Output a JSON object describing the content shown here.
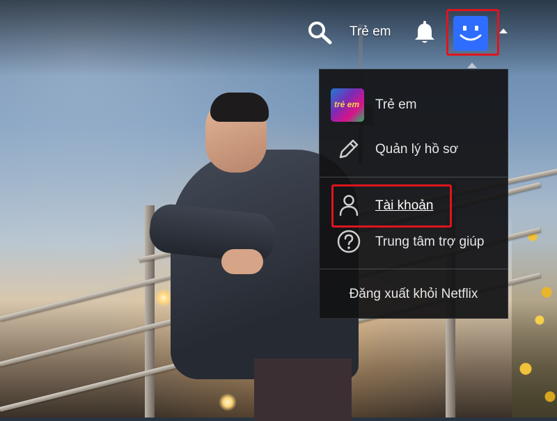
{
  "header": {
    "kids_label": "Trẻ em",
    "search_icon": "search-icon",
    "notifications_icon": "bell-icon",
    "profile_avatar": "smiley-avatar-icon",
    "avatar_color": "#2e6dff",
    "dropdown_icon": "caret-up-icon"
  },
  "dropdown": {
    "items": [
      {
        "label": "Trẻ em",
        "icon": "kids-profile-thumbnail",
        "thumb_text": "trẻ em"
      },
      {
        "label": "Quản lý hồ sơ",
        "icon": "pencil-icon"
      },
      {
        "label": "Tài khoản",
        "icon": "user-icon",
        "highlighted": true
      },
      {
        "label": "Trung tâm trợ giúp",
        "icon": "help-circle-icon"
      }
    ],
    "signout_label": "Đăng xuất khỏi Netflix"
  },
  "highlight_color": "#e0141e"
}
